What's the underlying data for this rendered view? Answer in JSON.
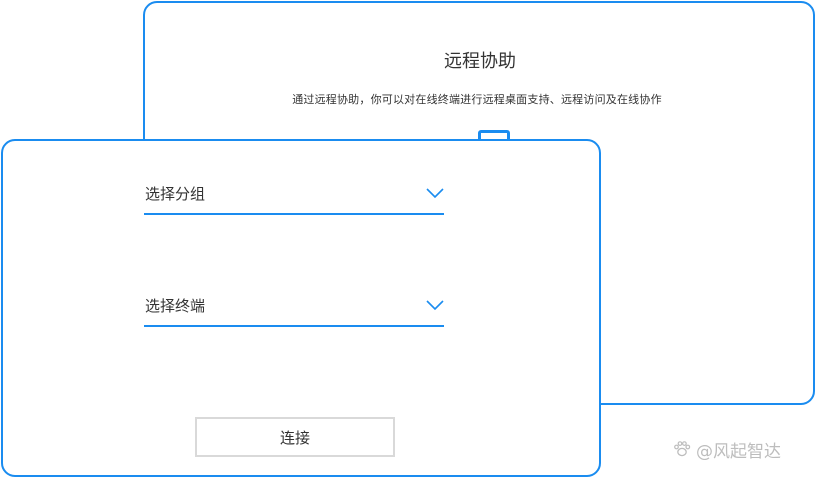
{
  "back_card": {
    "title": "远程协助",
    "subtitle": "通过远程协助，你可以对在线终端进行远程桌面支持、远程访问及在线协作"
  },
  "form": {
    "group_select": {
      "label": "选择分组",
      "icon": "chevron-down-icon"
    },
    "terminal_select": {
      "label": "选择终端",
      "icon": "chevron-down-icon"
    },
    "connect_label": "连接"
  },
  "watermark": {
    "text": "@风起智达",
    "icon": "paw-icon"
  },
  "colors": {
    "accent": "#1a8cf0",
    "green_dot": "#2fbf4a",
    "button_border": "#d9d9d9",
    "watermark": "#bdbdbd"
  }
}
